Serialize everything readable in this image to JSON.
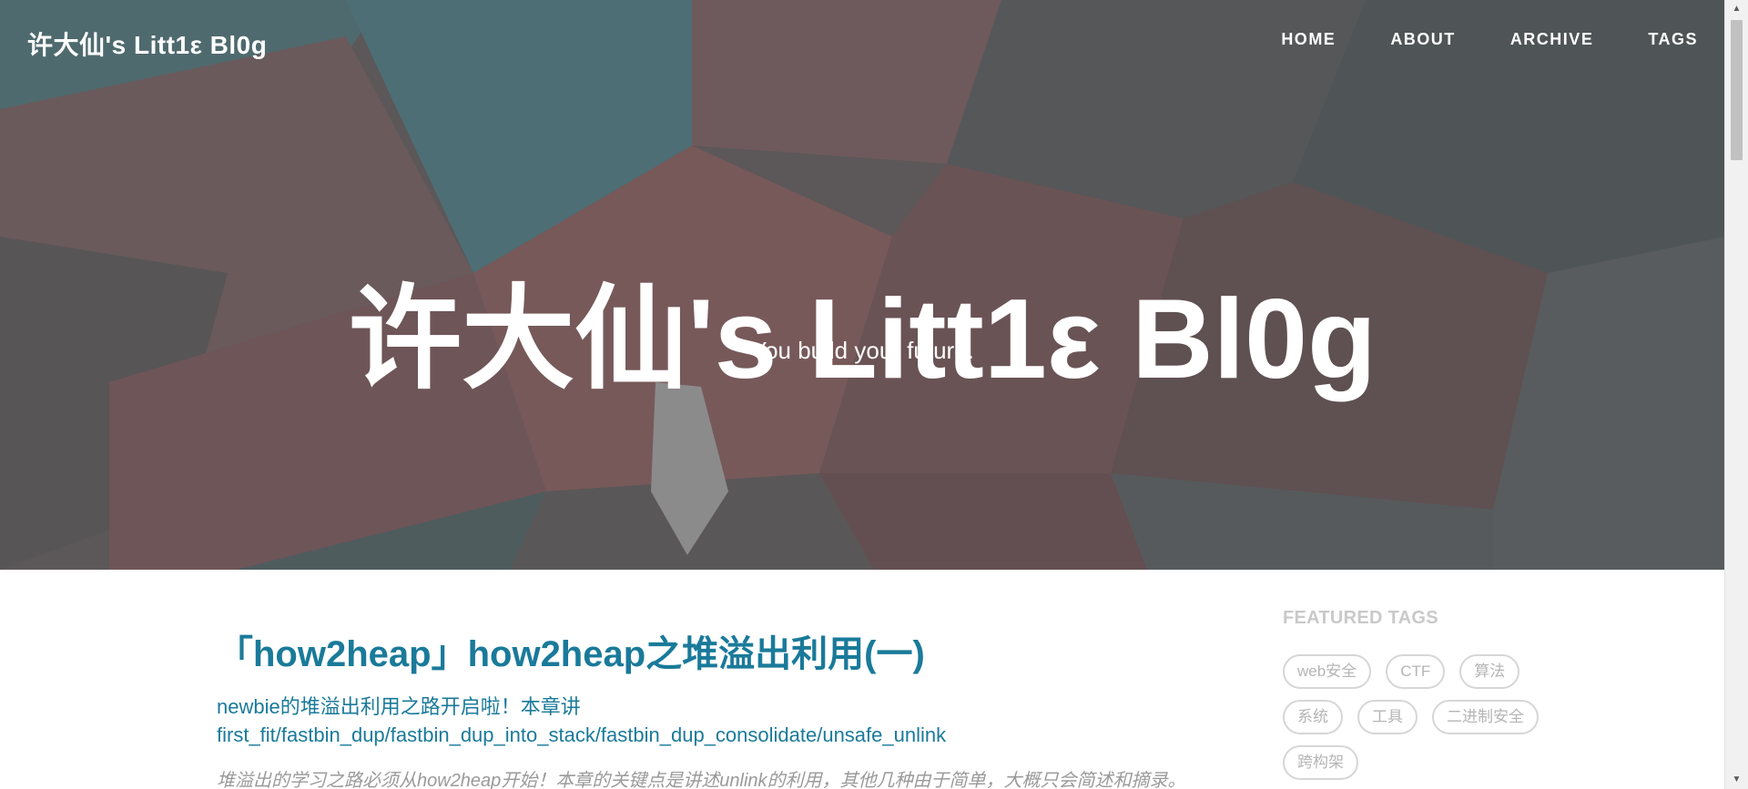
{
  "site": {
    "brand": "许大仙's Litt1ε Bl0g"
  },
  "nav": {
    "items": [
      "HOME",
      "ABOUT",
      "ARCHIVE",
      "TAGS"
    ]
  },
  "hero": {
    "title": "许大仙's Litt1ε Bl0g",
    "subtitle": "You build your future."
  },
  "post": {
    "title": "「how2heap」how2heap之堆溢出利用(一)",
    "subtitle_line1": "newbie的堆溢出利用之路开启啦！本章讲",
    "subtitle_line2": "first_fit/fastbin_dup/fastbin_dup_into_stack/fastbin_dup_consolidate/unsafe_unlink",
    "excerpt": "堆溢出的学习之路必须从how2heap开始！本章的关键点是讲述unlink的利用，其他几种由于简单，大概只会简述和摘录。"
  },
  "sidebar": {
    "heading": "FEATURED TAGS",
    "tags": [
      "web安全",
      "CTF",
      "算法",
      "系统",
      "工具",
      "二进制安全",
      "跨构架"
    ]
  },
  "colors": {
    "link": "#1a7a9a",
    "tag_text": "#b5b5b5",
    "hero_overlay": "#5a5556"
  }
}
